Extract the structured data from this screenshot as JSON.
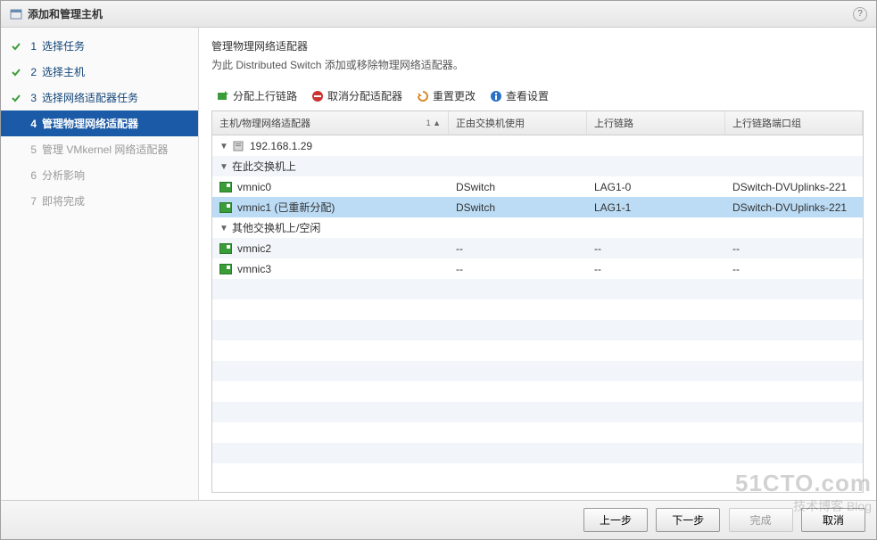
{
  "dialog": {
    "title": "添加和管理主机"
  },
  "steps": [
    {
      "num": "1",
      "label": "选择任务",
      "state": "done"
    },
    {
      "num": "2",
      "label": "选择主机",
      "state": "done"
    },
    {
      "num": "3",
      "label": "选择网络适配器任务",
      "state": "done"
    },
    {
      "num": "4",
      "label": "管理物理网络适配器",
      "state": "current"
    },
    {
      "num": "5",
      "label": "管理 VMkernel 网络适配器",
      "state": "pending"
    },
    {
      "num": "6",
      "label": "分析影响",
      "state": "pending"
    },
    {
      "num": "7",
      "label": "即将完成",
      "state": "pending"
    }
  ],
  "panel": {
    "heading": "管理物理网络适配器",
    "subheading": "为此 Distributed Switch 添加或移除物理网络适配器。"
  },
  "toolbar": {
    "assign": "分配上行链路",
    "unassign": "取消分配适配器",
    "reset": "重置更改",
    "view": "查看设置"
  },
  "grid": {
    "col1": "主机/物理网络适配器",
    "col2": "正由交换机使用",
    "col3": "上行链路",
    "col4": "上行链路端口组",
    "sort": "1 ▲"
  },
  "rows": [
    {
      "type": "host",
      "indent": 1,
      "label": "192.168.1.29",
      "c2": "",
      "c3": "",
      "c4": "",
      "sel": false,
      "toggle": "▼"
    },
    {
      "type": "group",
      "indent": 2,
      "label": "在此交换机上",
      "c2": "",
      "c3": "",
      "c4": "",
      "sel": false,
      "toggle": "▼"
    },
    {
      "type": "nic",
      "indent": 3,
      "label": "vmnic0",
      "c2": "DSwitch",
      "c3": "LAG1-0",
      "c4": "DSwitch-DVUplinks-221",
      "sel": false
    },
    {
      "type": "nic",
      "indent": 3,
      "label": "vmnic1 (已重新分配)",
      "c2": "DSwitch",
      "c3": "LAG1-1",
      "c4": "DSwitch-DVUplinks-221",
      "sel": true
    },
    {
      "type": "group",
      "indent": 2,
      "label": "其他交换机上/空闲",
      "c2": "",
      "c3": "",
      "c4": "",
      "sel": false,
      "toggle": "▼"
    },
    {
      "type": "nic",
      "indent": 3,
      "label": "vmnic2",
      "c2": "--",
      "c3": "--",
      "c4": "--",
      "sel": false
    },
    {
      "type": "nic",
      "indent": 3,
      "label": "vmnic3",
      "c2": "--",
      "c3": "--",
      "c4": "--",
      "sel": false
    }
  ],
  "footer": {
    "back": "上一步",
    "next": "下一步",
    "finish": "完成",
    "cancel": "取消"
  },
  "watermark": {
    "line1": "51CTO.com",
    "line2": "技术博客  Blog"
  }
}
